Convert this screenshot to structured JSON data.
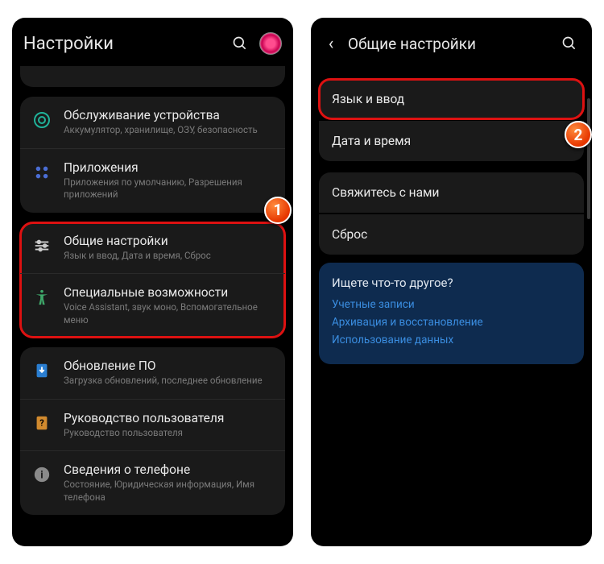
{
  "phone1": {
    "headerTitle": "Настройки",
    "badge": "1",
    "items": [
      {
        "title": "Обслуживание устройства",
        "sub": "Аккумулятор, хранилище, ОЗУ, безопасность"
      },
      {
        "title": "Приложения",
        "sub": "Приложения по умолчанию, Разрешения приложений"
      },
      {
        "title": "Общие настройки",
        "sub": "Язык и ввод, Дата и время, Сброс"
      },
      {
        "title": "Специальные возможности",
        "sub": "Voice Assistant, звук моно, Вспомогательное меню"
      },
      {
        "title": "Обновление ПО",
        "sub": "Загрузка обновлений, последнее обновление"
      },
      {
        "title": "Руководство пользователя",
        "sub": "Руководство пользователя"
      },
      {
        "title": "Сведения о телефоне",
        "sub": "Состояние, Юридическая информация, Имя телефона"
      }
    ]
  },
  "phone2": {
    "headerTitle": "Общие настройки",
    "badge": "2",
    "group1": [
      "Язык и ввод",
      "Дата и время"
    ],
    "group2": [
      "Свяжитесь с нами",
      "Сброс"
    ],
    "blue": {
      "q": "Ищете что-то другое?",
      "links": [
        "Учетные записи",
        "Архивация и восстановление",
        "Использование данных"
      ]
    }
  }
}
